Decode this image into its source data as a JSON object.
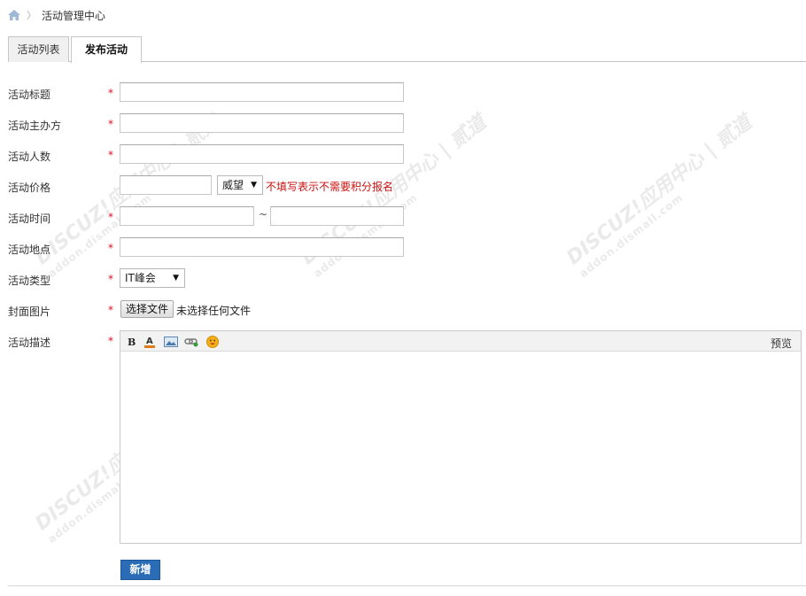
{
  "breadcrumb": {
    "separator": "〉",
    "current": "活动管理中心"
  },
  "tabs": [
    {
      "label": "活动列表",
      "active": false
    },
    {
      "label": "发布活动",
      "active": true
    }
  ],
  "form": {
    "required_mark": "*",
    "title": {
      "label": "活动标题",
      "value": ""
    },
    "organizer": {
      "label": "活动主办方",
      "value": ""
    },
    "attendees": {
      "label": "活动人数",
      "value": ""
    },
    "price": {
      "label": "活动价格",
      "value": "",
      "currency": "威望",
      "hint": "不填写表示不需要积分报名"
    },
    "time": {
      "label": "活动时间",
      "start": "",
      "separator": "~",
      "end": ""
    },
    "location": {
      "label": "活动地点",
      "value": ""
    },
    "type": {
      "label": "活动类型",
      "selected": "IT峰会"
    },
    "cover": {
      "label": "封面图片",
      "button": "选择文件",
      "status": "未选择任何文件"
    },
    "description": {
      "label": "活动描述",
      "preview": "预览"
    },
    "submit_label": "新增"
  },
  "editor_tools": [
    "bold-icon",
    "font-color-icon",
    "image-icon",
    "link-icon",
    "emoji-icon"
  ],
  "watermark": {
    "brand": "DISCUZ!应用中心 | 贰道",
    "url": "addon.dismall.com"
  },
  "colors": {
    "required": "#dd1122",
    "hint": "#cc1111",
    "button": "#2a6db6"
  }
}
